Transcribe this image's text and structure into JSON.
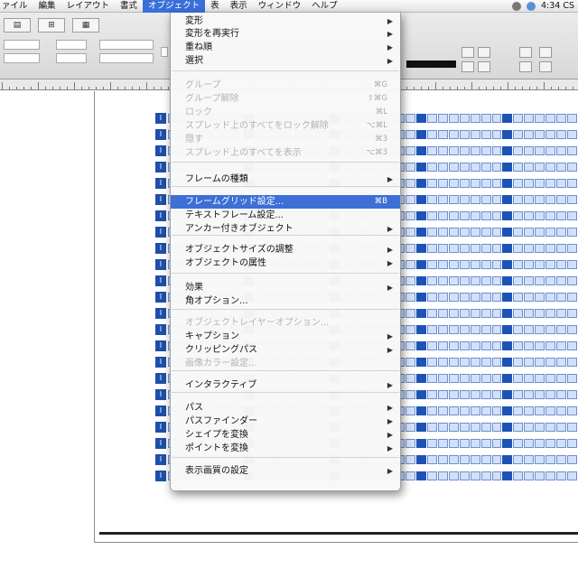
{
  "menubar": {
    "items": [
      "ァイル",
      "編集",
      "レイアウト",
      "書式",
      "オブジェクト",
      "表",
      "表示",
      "ウィンドウ",
      "ヘルプ"
    ],
    "active_index": 4,
    "clock": "4:34 CS"
  },
  "object_menu": {
    "items": [
      {
        "label": "変形",
        "arrow": "▶",
        "disabled": false
      },
      {
        "label": "変形を再実行",
        "arrow": "▶",
        "disabled": false
      },
      {
        "label": "重ね順",
        "arrow": "▶",
        "disabled": false
      },
      {
        "label": "選択",
        "arrow": "▶",
        "disabled": false
      },
      {
        "label": "グループ",
        "shortcut": "⌘G",
        "disabled": true
      },
      {
        "label": "グループ解除",
        "shortcut": "⇧⌘G",
        "disabled": true
      },
      {
        "label": "ロック",
        "shortcut": "⌘L",
        "disabled": true
      },
      {
        "label": "スプレッド上のすべてをロック解除",
        "shortcut": "⌥⌘L",
        "disabled": true
      },
      {
        "label": "隠す",
        "shortcut": "⌘3",
        "disabled": true
      },
      {
        "label": "スプレッド上のすべてを表示",
        "shortcut": "⌥⌘3",
        "disabled": true
      },
      {
        "label": "フレームの種類",
        "arrow": "▶",
        "disabled": false
      },
      {
        "label": "フレームグリッド設定...",
        "shortcut": "⌘B",
        "disabled": false,
        "selected": true
      },
      {
        "label": "テキストフレーム設定...",
        "disabled": false
      },
      {
        "label": "アンカー付きオブジェクト",
        "arrow": "▶",
        "disabled": false
      },
      {
        "label": "オブジェクトサイズの調整",
        "arrow": "▶",
        "disabled": false
      },
      {
        "label": "オブジェクトの属性",
        "arrow": "▶",
        "disabled": false
      },
      {
        "label": "効果",
        "arrow": "▶",
        "disabled": false
      },
      {
        "label": "角オプション...",
        "disabled": false
      },
      {
        "label": "オブジェクトレイヤーオプション...",
        "disabled": true
      },
      {
        "label": "キャプション",
        "arrow": "▶",
        "disabled": false
      },
      {
        "label": "クリッピングパス",
        "arrow": "▶",
        "disabled": false
      },
      {
        "label": "画像カラー設定...",
        "disabled": true
      },
      {
        "label": "インタラクティブ",
        "arrow": "▶",
        "disabled": false
      },
      {
        "label": "パス",
        "arrow": "▶",
        "disabled": false
      },
      {
        "label": "パスファインダー",
        "arrow": "▶",
        "disabled": false
      },
      {
        "label": "シェイプを変換",
        "arrow": "▶",
        "disabled": false
      },
      {
        "label": "ポイントを変換",
        "arrow": "▶",
        "disabled": false
      },
      {
        "label": "表示画質の設定",
        "arrow": "▶",
        "disabled": false
      }
    ]
  },
  "frame_grid": {
    "row_marker": "I"
  }
}
